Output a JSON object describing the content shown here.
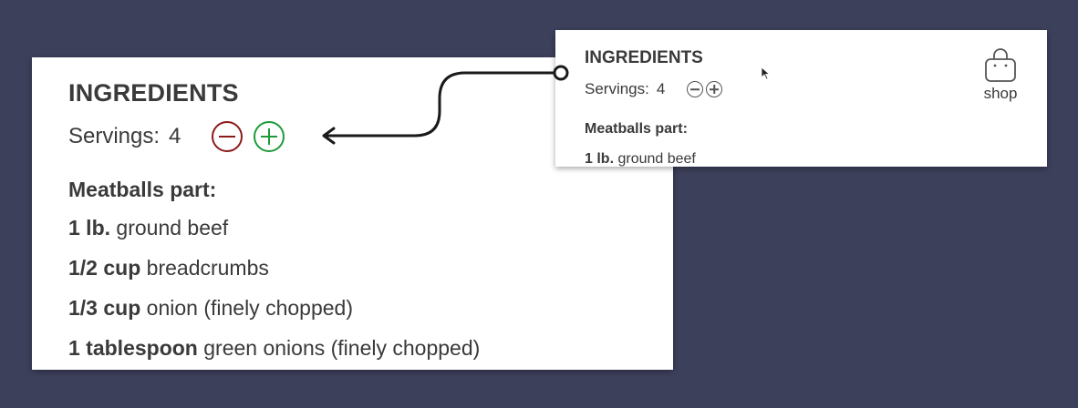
{
  "zoomed_card": {
    "title": "INGREDIENTS",
    "servings_label": "Servings:",
    "servings_count": "4",
    "section_heading": "Meatballs part:",
    "ingredients": [
      {
        "qty": "1 lb.",
        "item": "ground beef"
      },
      {
        "qty": "1/2 cup",
        "item": "breadcrumbs"
      },
      {
        "qty": "1/3 cup",
        "item": "onion (finely chopped)"
      },
      {
        "qty": "1 tablespoon",
        "item": "green onions (finely chopped)"
      }
    ]
  },
  "card": {
    "title": "INGREDIENTS",
    "servings_label": "Servings:",
    "servings_count": "4",
    "section_heading": "Meatballs part:",
    "first_ingredient": {
      "qty": "1 lb.",
      "item": "ground beef"
    },
    "shop_label": "shop"
  },
  "icons": {
    "decrease": "minus-circle-icon",
    "increase": "plus-circle-icon",
    "shop": "shopping-bag-icon",
    "cursor": "mouse-pointer-icon"
  },
  "colors": {
    "background": "#3d405b",
    "minus_accent": "#8b1a1a",
    "plus_accent": "#1f9a3a",
    "text": "#3a3a3a"
  }
}
